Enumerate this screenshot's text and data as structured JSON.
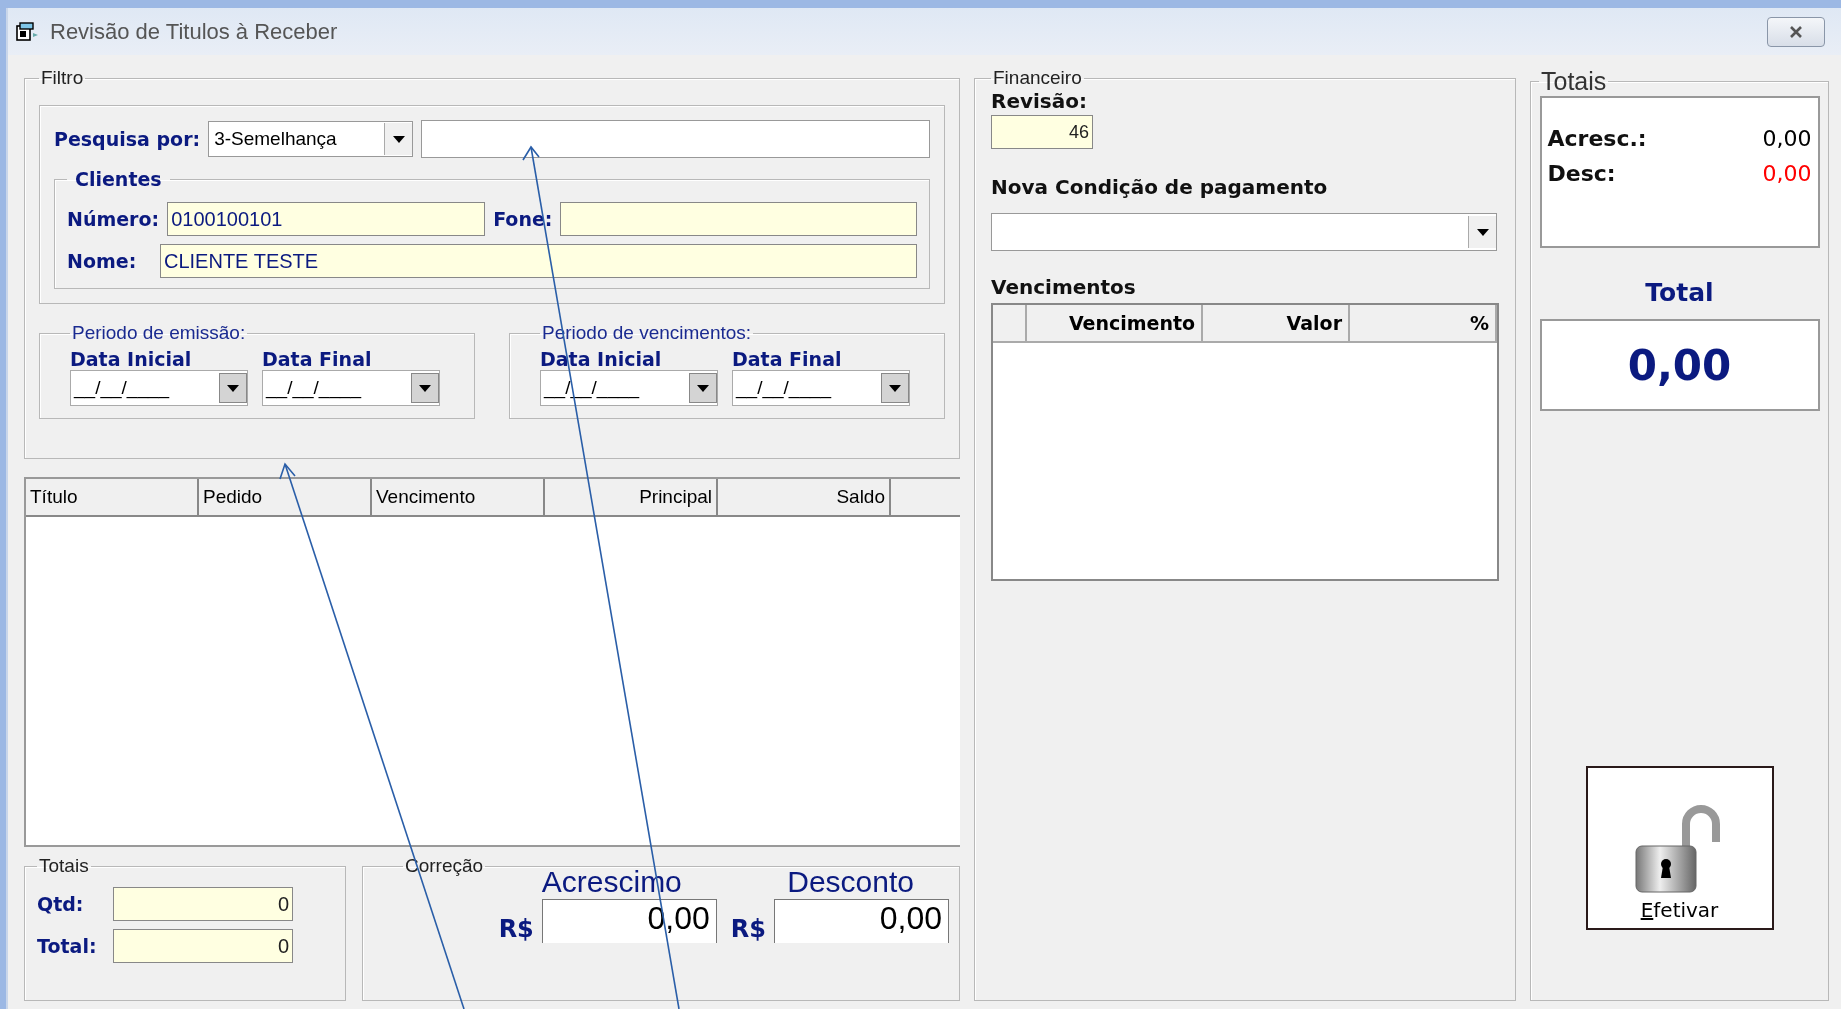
{
  "window": {
    "title": "Revisão de Titulos à Receber"
  },
  "filtro": {
    "legend": "Filtro",
    "search_label": "Pesquisa por:",
    "search_mode": "3-Semelhança",
    "clientes": {
      "legend": "Clientes",
      "numero_label": "Número:",
      "numero_value": "0100100101",
      "fone_label": "Fone:",
      "nome_label": "Nome:",
      "nome_value": "CLIENTE TESTE"
    },
    "periods": [
      {
        "legend": "Periodo de emissão:",
        "dates": [
          {
            "label": "Data Inicial",
            "value": "__/__/____"
          },
          {
            "label": "Data Final",
            "value": "__/__/____"
          }
        ]
      },
      {
        "legend": "Periodo de vencimentos:",
        "dates": [
          {
            "label": "Data Inicial",
            "value": "__/__/____"
          },
          {
            "label": "Data Final",
            "value": "__/__/____"
          }
        ]
      }
    ]
  },
  "table": {
    "columns": [
      {
        "label": "Título",
        "numeric": false
      },
      {
        "label": "Pedido",
        "numeric": false
      },
      {
        "label": "Vencimento",
        "numeric": false
      },
      {
        "label": "Principal",
        "numeric": true
      },
      {
        "label": "Saldo",
        "numeric": true
      }
    ]
  },
  "totais_left": {
    "legend": "Totais",
    "rows": [
      {
        "label": "Qtd:",
        "value": "0"
      },
      {
        "label": "Total:",
        "value": "0"
      }
    ]
  },
  "correcao": {
    "legend": "Correção",
    "items": [
      {
        "heading": "Acrescimo",
        "currency": "R$",
        "value": "0,00"
      },
      {
        "heading": "Desconto",
        "currency": "R$",
        "value": "0,00"
      }
    ]
  },
  "financeiro": {
    "legend": "Financeiro",
    "revisao_label": "Revisão:",
    "revisao_value": "46",
    "condicao_label": "Nova Condição de pagamento",
    "vencimentos_label": "Vencimentos",
    "columns": [
      {
        "label": "Vencimento"
      },
      {
        "label": "Valor"
      },
      {
        "label": "%"
      }
    ]
  },
  "totais_right": {
    "legend": "Totais",
    "rows": [
      {
        "label": "Acresc.:",
        "value": "0,00",
        "color": "#000000"
      },
      {
        "label": "Desc:",
        "value": "0,00",
        "color": "#ff0000"
      }
    ],
    "total_label": "Total",
    "total_value": "0,00",
    "button": "Efetivar"
  }
}
